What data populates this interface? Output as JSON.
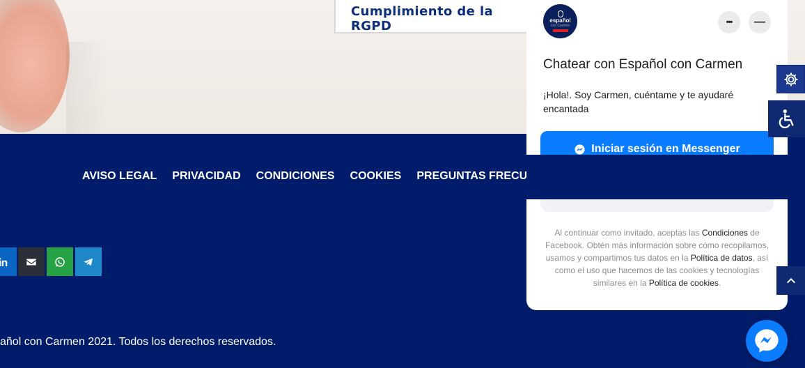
{
  "hero": {
    "card_title": "Cumplimiento de la RGPD"
  },
  "footer": {
    "nav": [
      {
        "label": "AVISO LEGAL"
      },
      {
        "label": "PRIVACIDAD"
      },
      {
        "label": "CONDICIONES"
      },
      {
        "label": "COOKIES"
      },
      {
        "label": "PREGUNTAS FRECUENTES (FAQ)"
      }
    ],
    "social": [
      {
        "icon": "linkedin-icon",
        "color": "#0a66c2"
      },
      {
        "icon": "mail-icon",
        "color": "#2b2f3a"
      },
      {
        "icon": "whatsapp-icon",
        "color": "#25a244"
      },
      {
        "icon": "telegram-icon",
        "color": "#1e88c9"
      }
    ],
    "copyright": "añol con Carmen 2021. Todos los derechos reservados."
  },
  "chat": {
    "logo": {
      "line1": "español",
      "line2": "con Carmen"
    },
    "more_label": "•••",
    "minimize_label": "—",
    "title": "Chatear con Español con Carmen",
    "greeting": "¡Hola!. Soy Carmen, cuéntame y te ayudaré encantada",
    "messenger_button": "Iniciar sesión en Messenger",
    "legal": {
      "p1": "Al continuar como invitado, aceptas las ",
      "conditions": "Condiciones",
      "p2": " de Facebook. Obtén más información sobre cómo recopilamos, usamos y compartimos tus datos en la ",
      "data_policy": "Política de datos",
      "p3": ", así como el uso que hacemos de las cookies y tecnologías similares en la ",
      "cookies_policy": "Política de cookies",
      "p4": "."
    }
  },
  "colors": {
    "footer_bg": "#001c6b",
    "messenger_blue": "#0a7cff",
    "card_text": "#0d2f7a"
  }
}
